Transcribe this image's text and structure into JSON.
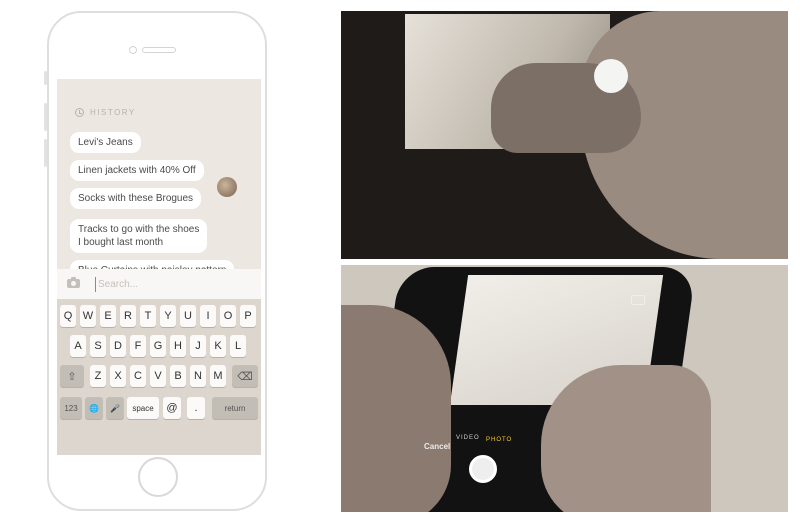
{
  "history": {
    "label": "HISTORY",
    "items": [
      "Levi's Jeans",
      "Linen jackets with 40% Off",
      "Socks with these Brogues",
      "Tracks to go with the shoes",
      "I bought last month",
      "Blue Curtains with paisley pattern"
    ]
  },
  "search": {
    "placeholder": "Search..."
  },
  "keyboard": {
    "row1": [
      "Q",
      "W",
      "E",
      "R",
      "T",
      "Y",
      "U",
      "I",
      "O",
      "P"
    ],
    "row2": [
      "A",
      "S",
      "D",
      "F",
      "G",
      "H",
      "J",
      "K",
      "L"
    ],
    "row3": [
      "Z",
      "X",
      "C",
      "V",
      "B",
      "N",
      "M"
    ],
    "shift": "⇧",
    "delete": "⌫",
    "numbers": "123",
    "globe": "🌐",
    "mic": "🎤",
    "space": "space",
    "at": "@",
    "dot": ".",
    "return": "return"
  },
  "camera": {
    "cancel": "Cancel",
    "video": "VIDEO",
    "photo": "PHOTO"
  }
}
